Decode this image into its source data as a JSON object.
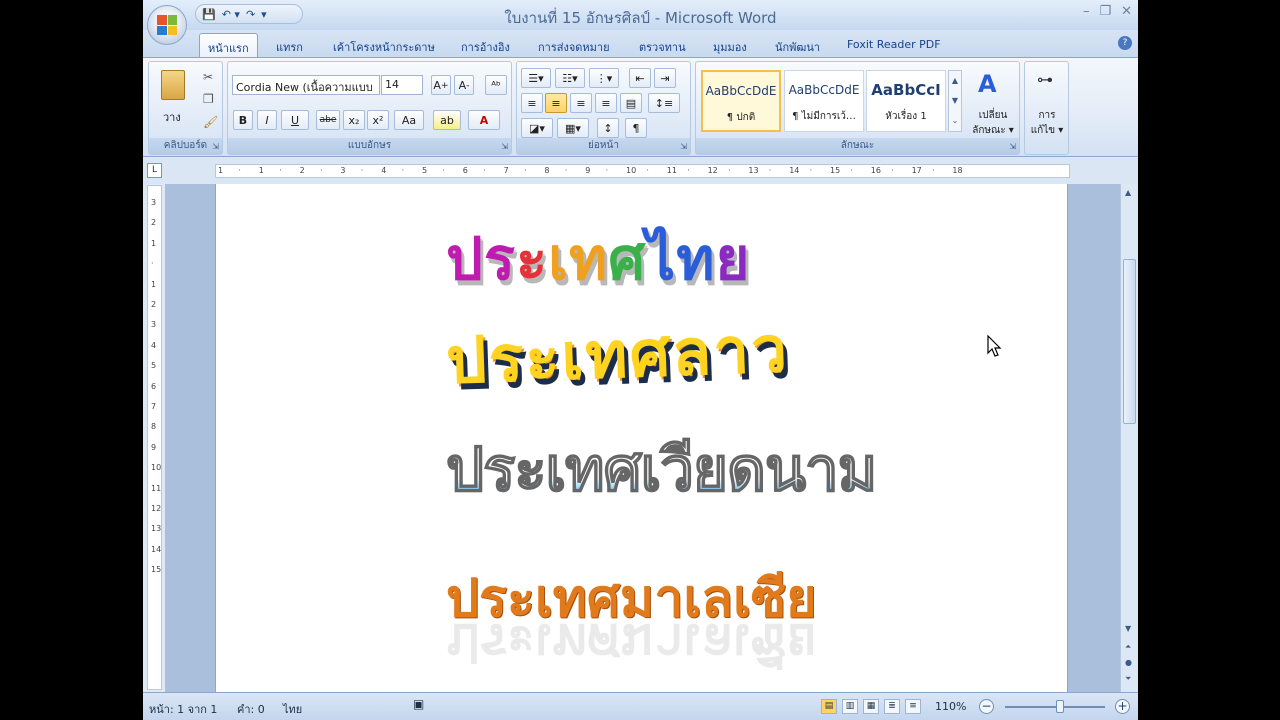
{
  "window": {
    "title": "ใบงานที่ 15 อักษรศิลป์ - Microsoft Word",
    "controls": [
      "–",
      "❐",
      "✕"
    ]
  },
  "qat": {
    "icons": [
      "save-icon",
      "undo-icon",
      "redo-icon",
      "customize-icon"
    ],
    "glyphs": [
      "💾",
      "↶ ▾",
      "↷",
      "▾"
    ]
  },
  "tabs": [
    "หน้าแรก",
    "แทรก",
    "เค้าโครงหน้ากระดาษ",
    "การอ้างอิง",
    "การส่งจดหมาย",
    "ตรวจทาน",
    "มุมมอง",
    "นักพัฒนา",
    "Foxit Reader PDF"
  ],
  "ribbon": {
    "clipboard": {
      "paste_label": "วาง",
      "group_label": "คลิปบอร์ด"
    },
    "font": {
      "name": "Cordia New (เนื้อความแบบ",
      "size": "14",
      "group_label": "แบบอักษร",
      "buttons": [
        "B",
        "I",
        "U",
        "abe",
        "x₂",
        "x²",
        "Aa"
      ]
    },
    "paragraph": {
      "group_label": "ย่อหน้า"
    },
    "styles": {
      "group_label": "ลักษณะ",
      "cards": [
        {
          "sample": "AaBbCcDdE",
          "name": "¶ ปกติ"
        },
        {
          "sample": "AaBbCcDdE",
          "name": "¶ ไม่มีการเว้…"
        },
        {
          "sample": "AaBbCcI",
          "name": "หัวเรื่อง 1"
        }
      ],
      "change_styles": "เปลี่ยน\nลักษณะ ▾"
    },
    "editing": {
      "label": "การ\nแก้ไข ▾"
    }
  },
  "ruler": {
    "h_marks": [
      "1",
      "·",
      "1",
      "·",
      "2",
      "·",
      "3",
      "·",
      "4",
      "·",
      "5",
      "·",
      "6",
      "·",
      "7",
      "·",
      "8",
      "·",
      "9",
      "·",
      "10",
      "·",
      "11",
      "·",
      "12",
      "·",
      "13",
      "·",
      "14",
      "·",
      "15",
      "·",
      "16",
      "·",
      "17",
      "·",
      "18"
    ],
    "v_marks": [
      "3",
      "2",
      "1",
      "·",
      "1",
      "2",
      "3",
      "4",
      "5",
      "6",
      "7",
      "8",
      "9",
      "10",
      "11",
      "12",
      "13",
      "14",
      "15"
    ]
  },
  "document": {
    "wordart": [
      {
        "text": "ประเทศไทย"
      },
      {
        "text": "ประเทศลาว"
      },
      {
        "text": "ประเทศเวียดนาม"
      },
      {
        "text": "ประเทศมาเลเซีย"
      }
    ]
  },
  "status": {
    "page": "หน้า: 1 จาก 1",
    "words": "คำ: 0",
    "language": "ไทย",
    "zoom": "110%",
    "zoom_fraction": 0.55
  },
  "colors": {
    "wa1_gradient": [
      "#c01ab0",
      "#e8303a",
      "#f0a020",
      "#3ab04a",
      "#2a5ed8",
      "#8a2ac0"
    ]
  }
}
